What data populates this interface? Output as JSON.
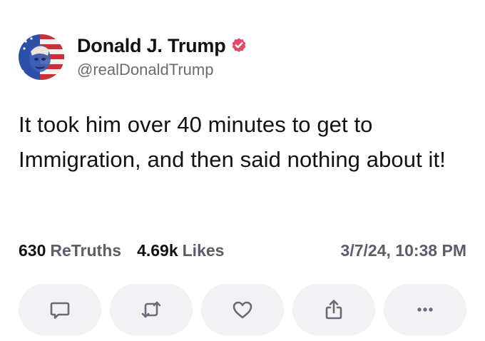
{
  "author": {
    "display_name": "Donald J. Trump",
    "handle": "@realDonaldTrump",
    "verified": true,
    "verified_color": "#e24a6b"
  },
  "post": {
    "text": "It took him over 40 minutes to get to Immigration, and then said nothing about it!"
  },
  "stats": {
    "retruths_count": "630",
    "retruths_label": "ReTruths",
    "likes_count": "4.69k",
    "likes_label": "Likes",
    "timestamp": "3/7/24, 10:38 PM"
  },
  "actions": [
    {
      "icon": "reply-icon"
    },
    {
      "icon": "retruth-icon"
    },
    {
      "icon": "like-icon"
    },
    {
      "icon": "share-icon"
    },
    {
      "icon": "more-icon"
    }
  ]
}
